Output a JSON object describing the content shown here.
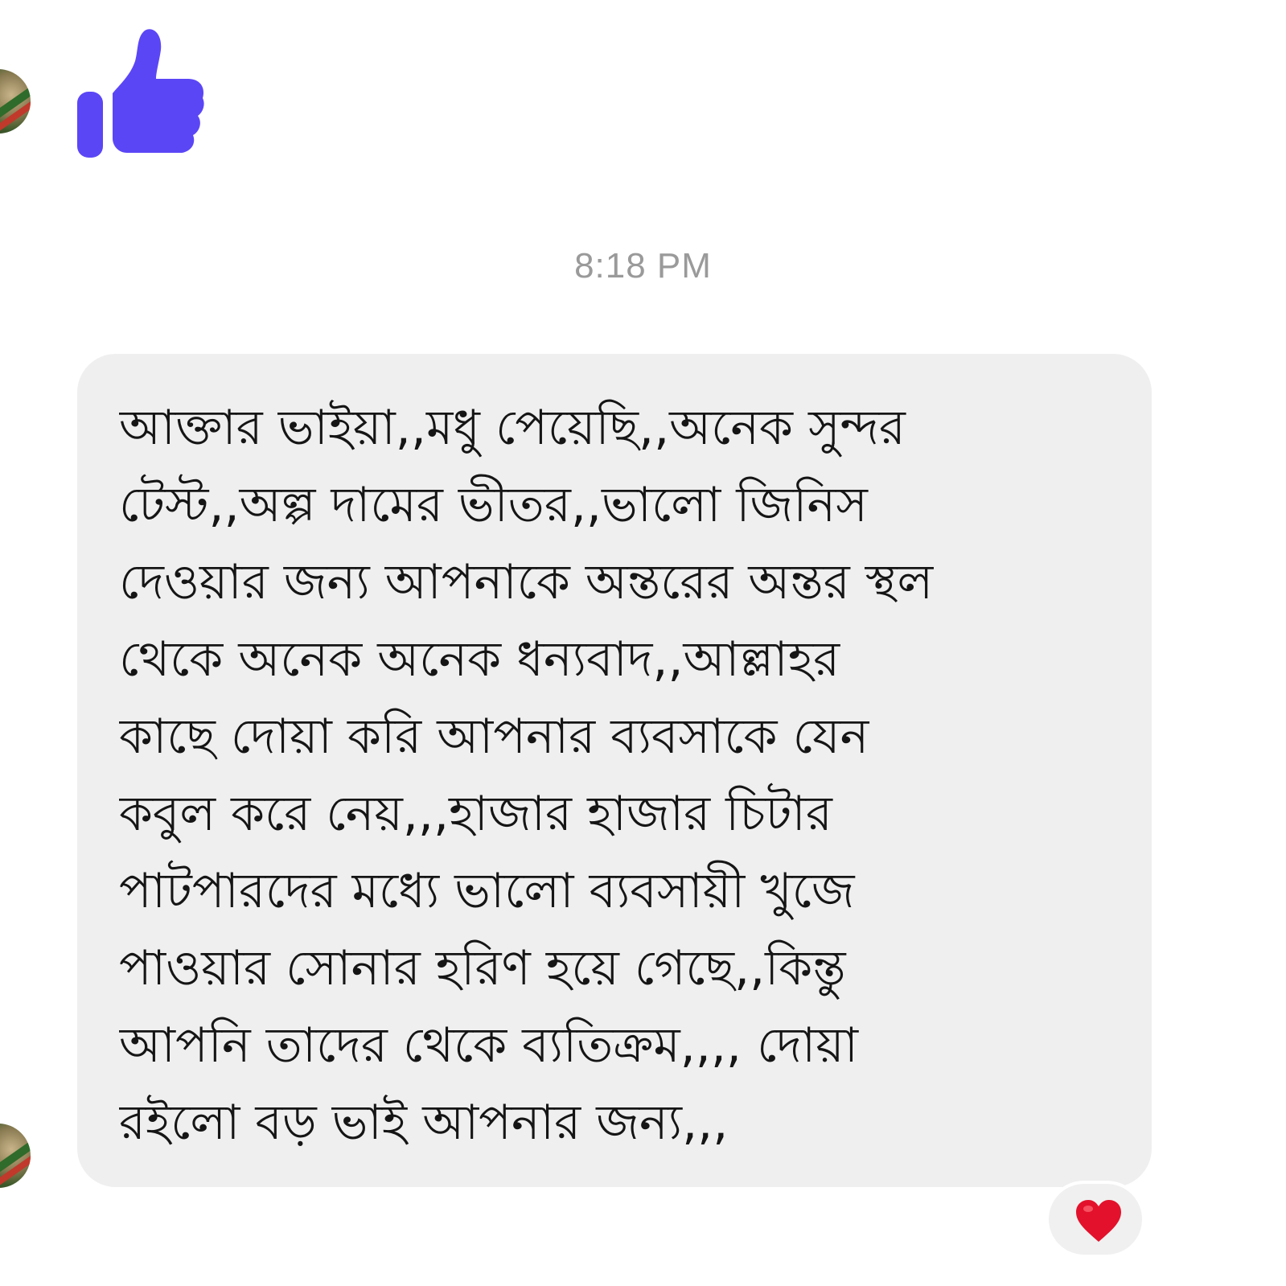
{
  "conversation": {
    "like_sticker": "thumbs-up-icon",
    "timestamp": "8:18 PM",
    "message": {
      "lines": [
        "আক্তার ভাইয়া,,মধু পেয়েছি,,অনেক সুন্দর",
        "টেস্ট,,অল্প দামের ভীতর,,ভালো জিনিস",
        "দেওয়ার জন্য আপনাকে অন্তরের অন্তর স্থল",
        "থেকে অনেক অনেক ধন্যবাদ,,আল্লাহর",
        "কাছে দোয়া করি আপনার ব্যবসাকে যেন",
        "কবুল করে নেয়,,,হাজার হাজার চিটার",
        "পাটপারদের মধ্যে ভালো ব্যবসায়ী খুজে",
        "পাওয়ার সোনার হরিণ হয়ে গেছে,,কিন্তু",
        "আপনি তাদের থেকে ব্যতিক্রম,,,, দোয়া",
        "রইলো বড় ভাই আপনার জন্য,,,"
      ]
    },
    "reaction": "heart-icon"
  },
  "colors": {
    "like": "#5b46f6",
    "bubble": "#efefef",
    "timestamp": "#9a9a9a",
    "heart": "#e3112b"
  }
}
